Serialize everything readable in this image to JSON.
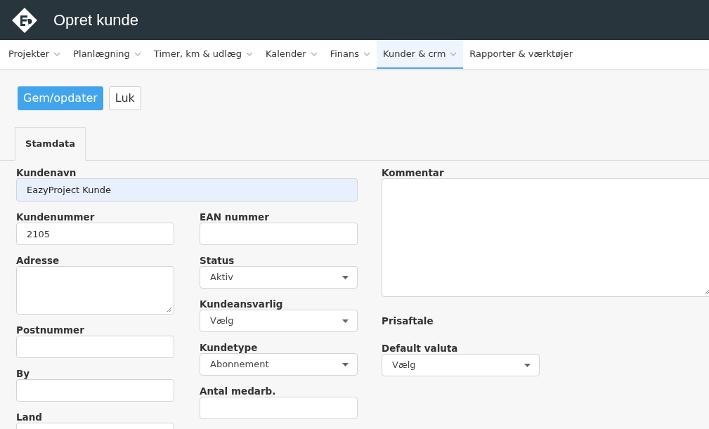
{
  "header": {
    "title": "Opret kunde"
  },
  "nav": [
    {
      "label": "Projekter",
      "selected": false,
      "has_menu": true
    },
    {
      "label": "Planlægning",
      "selected": false,
      "has_menu": true
    },
    {
      "label": "Timer, km & udlæg",
      "selected": false,
      "has_menu": true
    },
    {
      "label": "Kalender",
      "selected": false,
      "has_menu": true
    },
    {
      "label": "Finans",
      "selected": false,
      "has_menu": true
    },
    {
      "label": "Kunder & crm",
      "selected": true,
      "has_menu": true
    },
    {
      "label": "Rapporter & værktøjer",
      "selected": false,
      "has_menu": false
    }
  ],
  "actions": [
    {
      "label": "Gem/opdater",
      "kind": "primary"
    },
    {
      "label": "Luk",
      "kind": "default"
    }
  ],
  "tabs": [
    {
      "label": "Stamdata",
      "selected": true
    }
  ],
  "name_field": {
    "label": "Kundenavn",
    "value": "EazyProject Kunde",
    "autofilled": true
  },
  "left_fields": [
    {
      "label": "Kundenummer",
      "kind": "text",
      "value": "2105"
    },
    {
      "label": "Adresse",
      "kind": "textarea"
    },
    {
      "label": "Postnummer",
      "kind": "text"
    },
    {
      "label": "By",
      "kind": "text"
    },
    {
      "label": "Land",
      "kind": "text"
    }
  ],
  "middle_fields": [
    {
      "label": "EAN nummer",
      "kind": "text"
    },
    {
      "label": "Status",
      "kind": "select",
      "value": "Aktiv"
    },
    {
      "label": "Kundeansvarlig",
      "kind": "select",
      "value": "Vælg"
    },
    {
      "label": "Kundetype",
      "kind": "select",
      "value": "Abonnement"
    },
    {
      "label": "Antal medarb.",
      "kind": "text"
    }
  ],
  "right_fields": [
    {
      "label": "Kommentar",
      "kind": "bigtextarea"
    },
    {
      "label": "Prisaftale",
      "kind": "heading"
    },
    {
      "label": "Default valuta",
      "kind": "select",
      "value": "Vælg"
    }
  ]
}
